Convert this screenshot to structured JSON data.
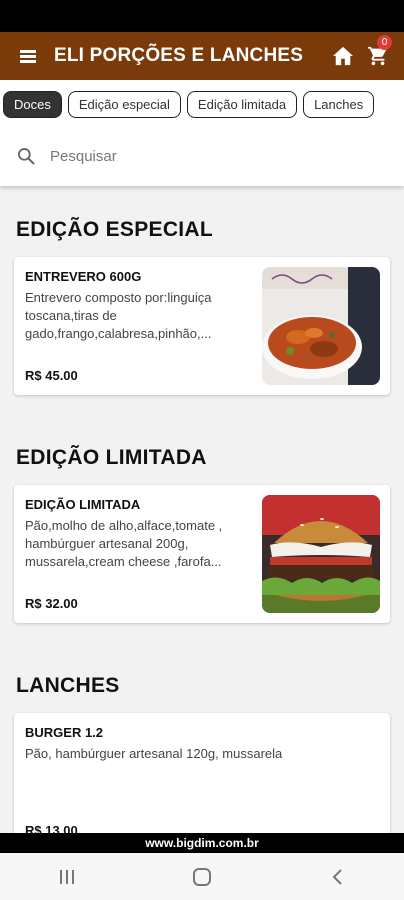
{
  "app": {
    "title": "ELI PORÇÕES E LANCHES",
    "cart_count": "0"
  },
  "categories": {
    "chips": [
      "Doces",
      "Edição especial",
      "Edição limitada",
      "Lanches"
    ],
    "active_index": 0
  },
  "search": {
    "placeholder": "Pesquisar"
  },
  "sections": [
    {
      "title": "EDIÇÃO ESPECIAL",
      "items": [
        {
          "name": "ENTREVERO 600G",
          "description": "Entrevero composto por:linguiça toscana,tiras de gado,frango,calabresa,pinhão,...",
          "price": "R$ 45.00",
          "image": "entrevero-dish-photo"
        }
      ]
    },
    {
      "title": "EDIÇÃO LIMITADA",
      "items": [
        {
          "name": "EDIÇÃO LIMITADA",
          "description": "Pão,molho de alho,alface,tomate , hambúrguer artesanal 200g, mussarela,cream cheese ,farofa...",
          "price": "R$ 32.00",
          "image": "burger-photo"
        }
      ]
    },
    {
      "title": "LANCHES",
      "items": [
        {
          "name": "BURGER 1.2",
          "description": "Pão, hambúrguer artesanal 120g, mussarela",
          "price": "R$ 13.00"
        }
      ]
    }
  ],
  "footer": {
    "site": "www.bigdim.com.br"
  },
  "colors": {
    "appbar": "#7a3a0a",
    "badge": "#e53935",
    "active_chip": "#333333"
  }
}
